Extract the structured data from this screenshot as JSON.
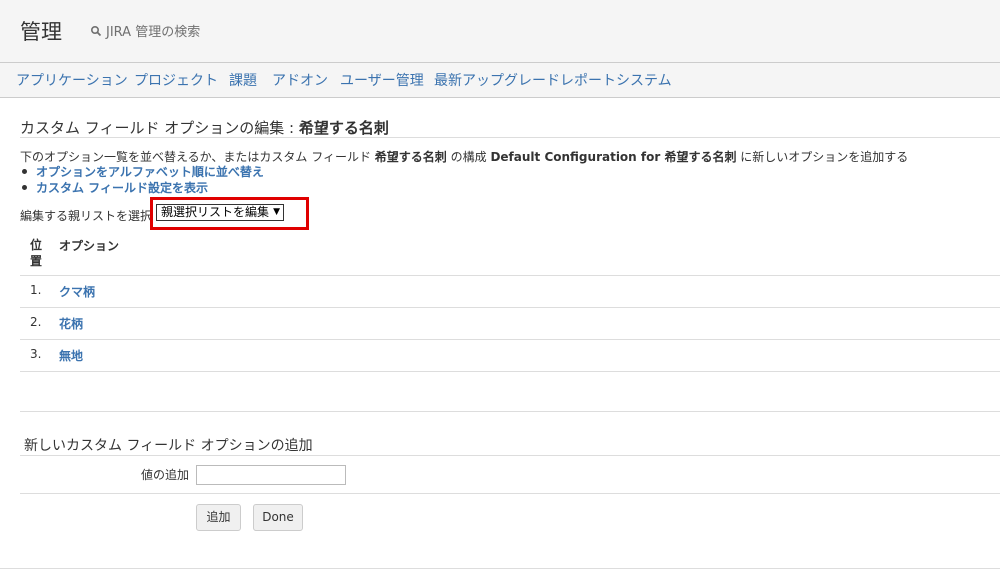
{
  "header": {
    "title": "管理",
    "search_label": "JIRA 管理の検索"
  },
  "nav": {
    "tabs": [
      "アプリケーション",
      "プロジェクト",
      "課題",
      "アドオン",
      "ユーザー管理",
      "最新アップグレードレポート",
      "システム"
    ]
  },
  "page": {
    "heading_prefix": "カスタム フィールド オプションの編集 : ",
    "heading_field": "希望する名刺",
    "desc_part1": "下のオプション一覧を並べ替えるか、またはカスタム フィールド ",
    "desc_field": "希望する名刺",
    "desc_part2": " の構成 ",
    "desc_config": "Default Configuration for 希望する名刺",
    "desc_part3": " に新しいオプションを追加する",
    "links": [
      "オプションをアルファベット順に並べ替え",
      "カスタム フィールド設定を表示"
    ],
    "parent_label": "編集する親リストを選択",
    "parent_select_value": "親選択リストを編集"
  },
  "table": {
    "headers": [
      "位置",
      "オプション"
    ],
    "rows": [
      {
        "pos": "1.",
        "option": "クマ柄"
      },
      {
        "pos": "2.",
        "option": "花柄"
      },
      {
        "pos": "3.",
        "option": "無地"
      }
    ]
  },
  "add_form": {
    "heading": "新しいカスタム フィールド オプションの追加",
    "value_label": "値の追加",
    "value_input": "",
    "add_button": "追加",
    "done_button": "Done"
  },
  "colors": {
    "link": "#3b73af",
    "highlight": "#e00000",
    "header_bg": "#f5f5f5"
  }
}
